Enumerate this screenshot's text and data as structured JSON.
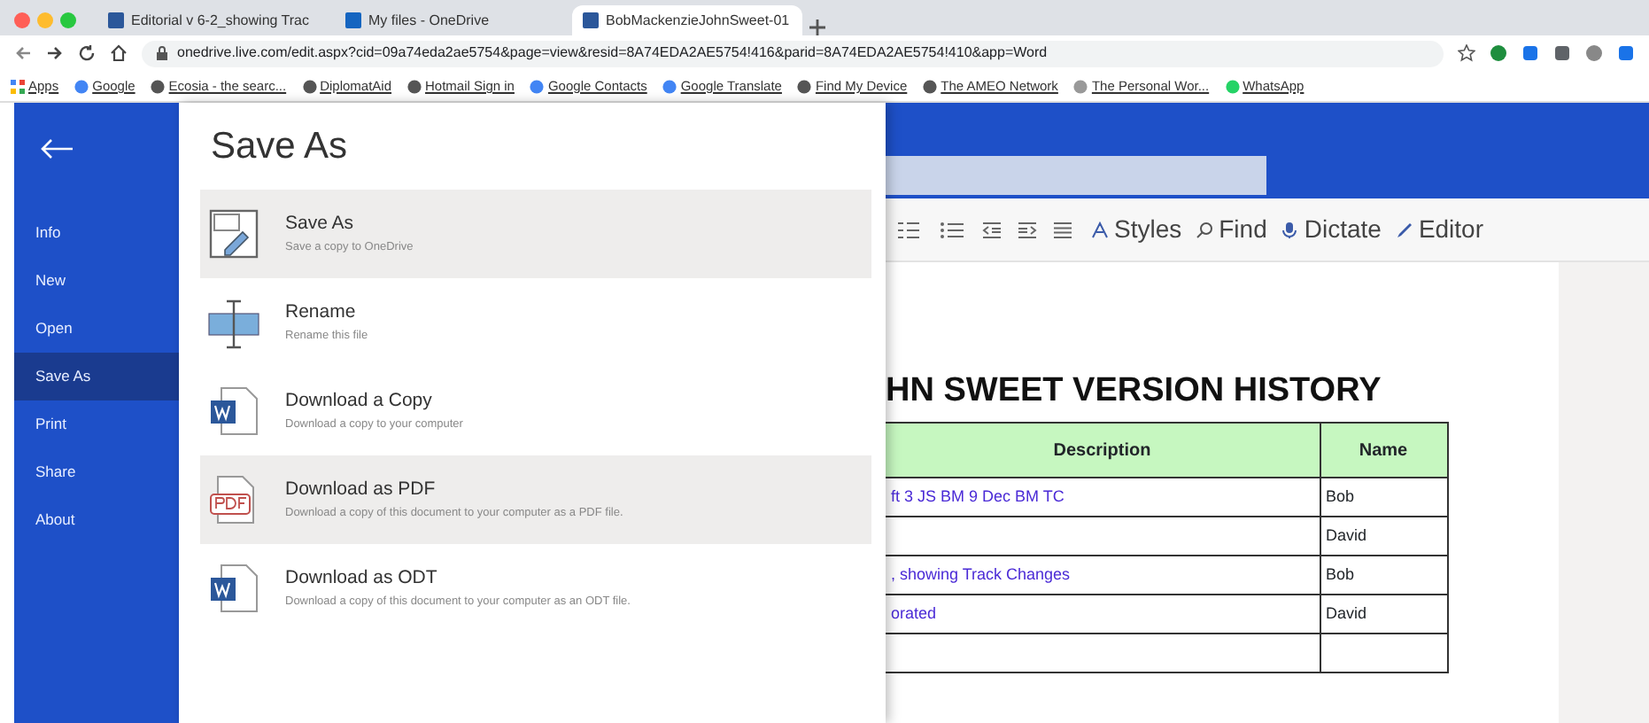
{
  "browser": {
    "tabs": [
      {
        "label": "Editorial v 6-2_showing Trac",
        "selected": false
      },
      {
        "label": "My files - OneDrive",
        "selected": false
      },
      {
        "label": "BobMackenzieJohnSweet-01",
        "selected": true
      }
    ],
    "url": "onedrive.live.com/edit.aspx?cid=09a74eda2ae5754&page=view&resid=8A74EDA2AE5754!416&parid=8A74EDA2AE5754!410&app=Word",
    "bookmarks": [
      "Apps",
      "Google",
      "Ecosia - the searc...",
      "DiplomatAid",
      "Hotmail Sign in",
      "Google Contacts",
      "Google Translate",
      "Find My Device",
      "The AMEO Network",
      "The Personal Wor...",
      "WhatsApp"
    ]
  },
  "sidebar": {
    "items": [
      {
        "label": "Info",
        "selected": false
      },
      {
        "label": "New",
        "selected": false
      },
      {
        "label": "Open",
        "selected": false
      },
      {
        "label": "Save As",
        "selected": true
      },
      {
        "label": "Print",
        "selected": false
      },
      {
        "label": "Share",
        "selected": false
      },
      {
        "label": "About",
        "selected": false
      }
    ]
  },
  "panel": {
    "title": "Save As",
    "options": [
      {
        "kind": "save",
        "title": "Save As",
        "description": "Save a copy to OneDrive",
        "highlighted": true
      },
      {
        "kind": "rename",
        "title": "Rename",
        "description": "Rename this file",
        "highlighted": false
      },
      {
        "kind": "word",
        "title": "Download a Copy",
        "description": "Download a copy to your computer",
        "highlighted": false
      },
      {
        "kind": "pdf",
        "title": "Download as PDF",
        "description": "Download a copy of this document to your computer as a PDF file.",
        "highlighted": true
      },
      {
        "kind": "word",
        "title": "Download as ODT",
        "description": "Download a copy of this document to your computer as an ODT file.",
        "highlighted": false
      }
    ]
  },
  "toolbar": [
    "Styles",
    "Find",
    "Dictate",
    "Editor"
  ],
  "document": {
    "heading": "HN SWEET VERSION HISTORY",
    "table": {
      "columns": [
        "Description",
        "Name"
      ],
      "rows": [
        [
          "ft 3 JS BM 9 Dec BM TC",
          "Bob"
        ],
        [
          "",
          "David"
        ],
        [
          ", showing Track Changes",
          "Bob"
        ],
        [
          "orated",
          "David"
        ],
        [
          "",
          ""
        ]
      ]
    }
  }
}
